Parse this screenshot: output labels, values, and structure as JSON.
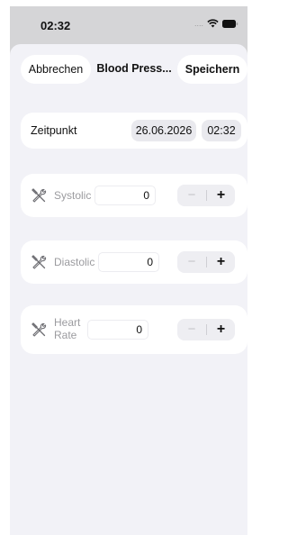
{
  "status": {
    "time": "02:32",
    "signal": "....",
    "wifi_icon": "wifi-icon",
    "battery_icon": "battery-icon"
  },
  "nav": {
    "cancel": "Abbrechen",
    "title": "Blood Press...",
    "save": "Speichern"
  },
  "timestamp": {
    "label": "Zeitpunkt",
    "date": "26.06.2026",
    "time": "02:32"
  },
  "metrics": [
    {
      "label": "Systolic",
      "value": "0",
      "icon": "tools-icon"
    },
    {
      "label": "Diastolic",
      "value": "0",
      "icon": "tools-icon"
    },
    {
      "label": "Heart Rate",
      "label_line1": "Heart",
      "label_line2": "Rate",
      "value": "0",
      "icon": "tools-icon"
    }
  ],
  "stepper": {
    "minus": "−",
    "plus": "+"
  }
}
